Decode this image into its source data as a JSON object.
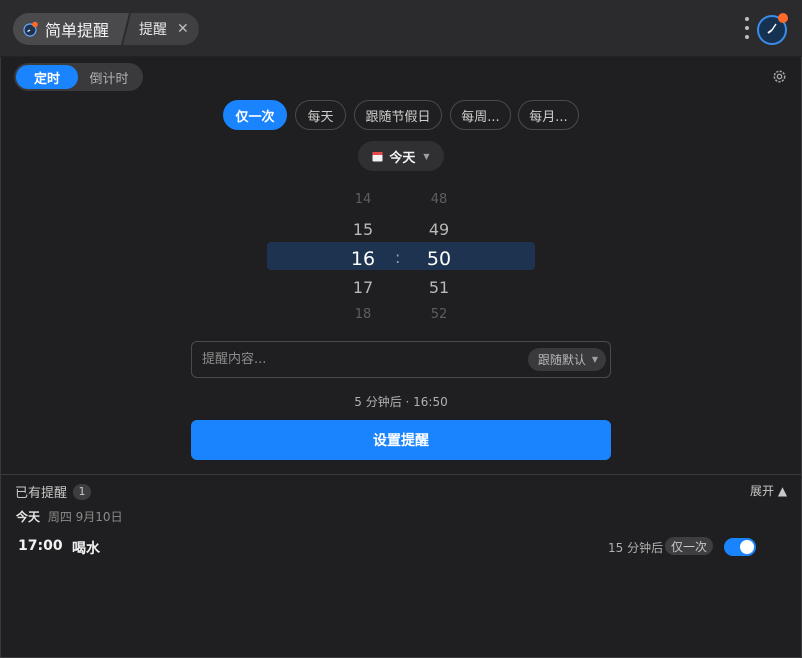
{
  "titlebar": {
    "app_name": "简单提醒",
    "tab_label": "提醒",
    "icons": [
      "app-logo-icon",
      "tab-close-icon",
      "more-vertical-icon",
      "clock-avatar-icon"
    ]
  },
  "mode": {
    "active": "定时",
    "inactive": "倒计时"
  },
  "repeat_options": [
    {
      "label": "仅一次",
      "active": true
    },
    {
      "label": "每天",
      "active": false
    },
    {
      "label": "跟随节假日",
      "active": false
    },
    {
      "label": "每周...",
      "active": false
    },
    {
      "label": "每月...",
      "active": false
    }
  ],
  "date_picker": {
    "label": "今天"
  },
  "time_picker": {
    "hours": [
      "14",
      "15",
      "16",
      "17",
      "18"
    ],
    "minutes": [
      "48",
      "49",
      "50",
      "51",
      "52"
    ],
    "separator": ":"
  },
  "reminder_input": {
    "placeholder": "提醒内容...",
    "value": "",
    "ring_mode": "跟随默认"
  },
  "hint": "5 分钟后 · 16:50",
  "set_button": "设置提醒",
  "existing": {
    "title": "已有提醒",
    "count": "1",
    "expand_label": "展开 ▲",
    "day_label": "今天",
    "day_date": "周四 9月10日",
    "items": [
      {
        "time": "17:00",
        "title": "喝水",
        "remaining": "15 分钟后",
        "repeat": "仅一次",
        "enabled": true
      }
    ]
  },
  "colors": {
    "accent": "#1a84ff",
    "background": "#1f1f21",
    "titlebar": "#2b2b2d",
    "highlight": "#1d3350"
  }
}
